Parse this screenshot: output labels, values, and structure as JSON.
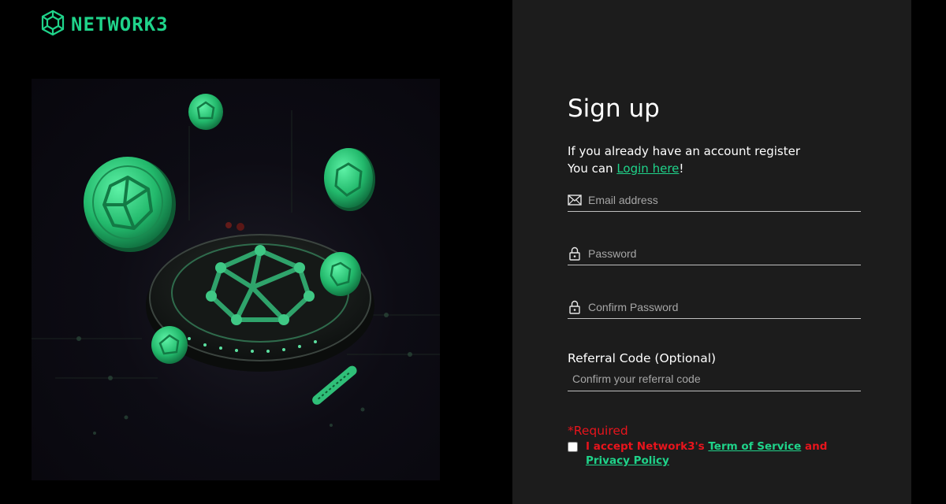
{
  "brand": {
    "name": "NETWORK3",
    "accent": "#1fd38a"
  },
  "signup": {
    "title": "Sign up",
    "subtitle_line1": "If you already have an account register",
    "subtitle_prefix": "You can ",
    "login_link": "Login here",
    "subtitle_suffix": "!",
    "email": {
      "placeholder": "Email address",
      "icon": "envelope-icon",
      "value": ""
    },
    "password": {
      "placeholder": "Password",
      "icon": "lock-icon",
      "value": ""
    },
    "confirm_password": {
      "placeholder": "Confirm Password",
      "icon": "lock-icon",
      "value": ""
    },
    "referral": {
      "label": "Referral Code (Optional)",
      "placeholder": "Confirm your referral code",
      "value": ""
    },
    "required": "*Required",
    "terms_prefix": "I accept Network3's ",
    "terms_link": "Term of Service",
    "terms_and": " and ",
    "privacy_link": "Privacy Policy",
    "terms_checked": false
  },
  "colors": {
    "panel_bg": "#1c1c1c",
    "page_bg": "#000000",
    "required_red": "#e8141c",
    "link_green": "#1fd38a"
  }
}
